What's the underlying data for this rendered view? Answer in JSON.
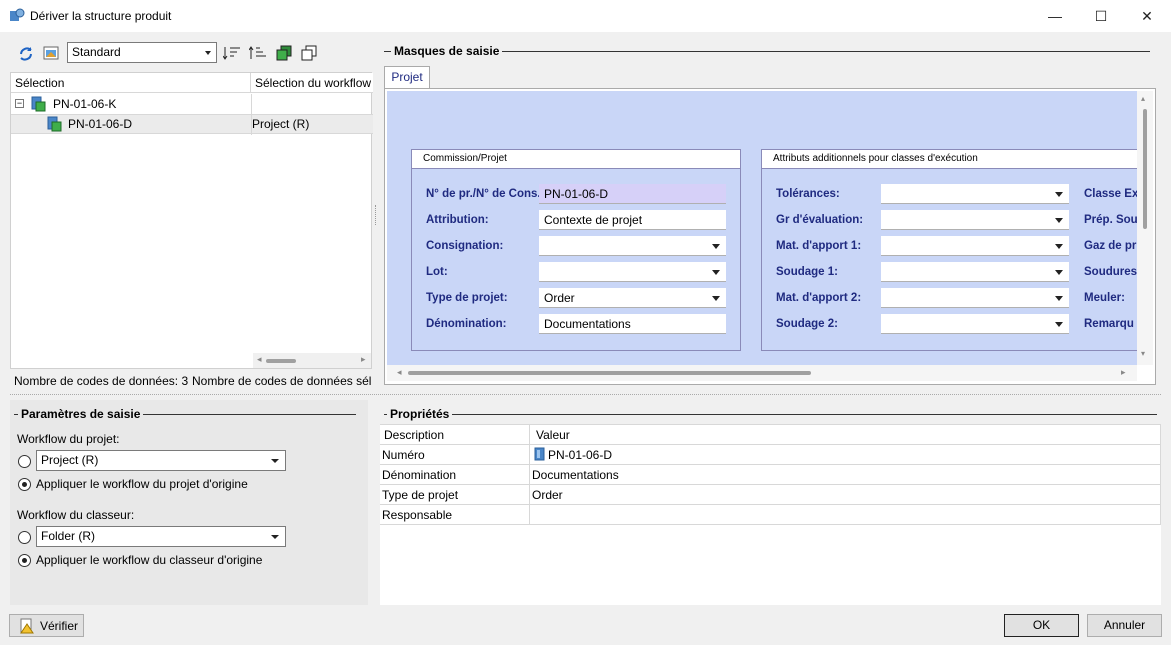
{
  "window": {
    "title": "Dériver la structure produit",
    "controls": {
      "minimize": "—",
      "maximize": "☐",
      "close": "✕"
    }
  },
  "toolbar": {
    "view_select": "Standard"
  },
  "tree": {
    "col_selection": "Sélection",
    "col_workflow": "Sélection du workflow",
    "rows": [
      {
        "name": "PN-01-06-K",
        "workflow": ""
      },
      {
        "name": "PN-01-06-D",
        "workflow": "Project (R)"
      }
    ],
    "status_left": "Nombre de codes de données: 3",
    "status_right": "Nombre de codes de données séle"
  },
  "masks": {
    "section_title": "Masques de saisie",
    "tab_label": "Projet",
    "group1": {
      "title": "Commission/Projet",
      "fields": [
        {
          "label": "N° de pr./N° de Cons.",
          "value": "PN-01-06-D",
          "type": "text",
          "highlight": true
        },
        {
          "label": "Attribution:",
          "value": "Contexte de projet",
          "type": "text"
        },
        {
          "label": "Consignation:",
          "value": "",
          "type": "dropdown"
        },
        {
          "label": "Lot:",
          "value": "",
          "type": "dropdown"
        },
        {
          "label": "Type de projet:",
          "value": "Order",
          "type": "dropdown"
        },
        {
          "label": "Dénomination:",
          "value": "Documentations",
          "type": "text"
        }
      ]
    },
    "group2": {
      "title": "Attributs additionnels pour classes d'exécution",
      "fields": [
        {
          "label": "Tolérances:",
          "value": ""
        },
        {
          "label": "Gr d'évaluation:",
          "value": ""
        },
        {
          "label": "Mat. d'apport 1:",
          "value": ""
        },
        {
          "label": "Soudage 1:",
          "value": ""
        },
        {
          "label": "Mat. d'apport 2:",
          "value": ""
        },
        {
          "label": "Soudage 2:",
          "value": ""
        }
      ],
      "extra_labels": [
        "Classe Ex",
        "Prép. Sou",
        "Gaz de pr",
        "Soudures:",
        "Meuler:",
        "Remarqu"
      ]
    }
  },
  "params": {
    "section_title": "Paramètres de saisie",
    "project_workflow_label": "Workflow du projet:",
    "project_workflow_value": "Project (R)",
    "project_apply_origin": "Appliquer le workflow du projet d'origine",
    "binder_workflow_label": "Workflow du classeur:",
    "binder_workflow_value": "Folder (R)",
    "binder_apply_origin": "Appliquer le workflow du classeur d'origine"
  },
  "properties": {
    "section_title": "Propriétés",
    "col_description": "Description",
    "col_value": "Valeur",
    "rows": [
      {
        "label": "Numéro",
        "value": "PN-01-06-D"
      },
      {
        "label": "Dénomination",
        "value": "Documentations"
      },
      {
        "label": "Type de projet",
        "value": "Order"
      },
      {
        "label": "Responsable",
        "value": ""
      }
    ]
  },
  "buttons": {
    "verify": "Vérifier",
    "ok": "OK",
    "cancel": "Annuler"
  },
  "colors": {
    "accent_blue": "#1f2a80",
    "mask_bg": "#c9d6f7",
    "highlight_field": "#d6d0f8"
  }
}
